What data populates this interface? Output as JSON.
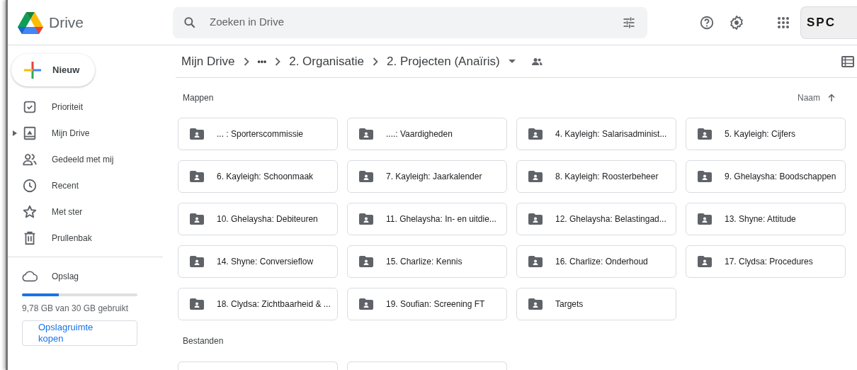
{
  "app": {
    "name": "Drive"
  },
  "search": {
    "placeholder": "Zoeken in Drive"
  },
  "account": {
    "logo_text": "SPC"
  },
  "new_button": {
    "label": "Nieuw"
  },
  "sidebar": {
    "items": [
      {
        "kind": "priority",
        "label": "Prioriteit",
        "expander": false
      },
      {
        "kind": "my-drive",
        "label": "Mijn Drive",
        "expander": true
      },
      {
        "kind": "shared",
        "label": "Gedeeld met mij",
        "expander": false
      },
      {
        "kind": "recent",
        "label": "Recent",
        "expander": false
      },
      {
        "kind": "starred",
        "label": "Met ster",
        "expander": false
      },
      {
        "kind": "trash",
        "label": "Prullenbak",
        "expander": false
      }
    ],
    "storage": {
      "label": "Opslag",
      "level": 0.32,
      "usage": "9,78 GB van 30 GB gebruikt",
      "buy_button": "Opslagruimte kopen"
    }
  },
  "breadcrumb": [
    {
      "kind": "link",
      "label": "Mijn Drive"
    },
    {
      "kind": "more",
      "label": "•••"
    },
    {
      "kind": "link",
      "label": "2. Organisatie"
    },
    {
      "kind": "current",
      "label": "2. Projecten (Anaïris)"
    }
  ],
  "folders_section": {
    "title": "Mappen",
    "sort_label": "Naam"
  },
  "folders": [
    {
      "name": "... : Sporterscommissie"
    },
    {
      "name": "....: Vaardigheden"
    },
    {
      "name": "4. Kayleigh: Salarisadminist..."
    },
    {
      "name": "5. Kayleigh: Cijfers"
    },
    {
      "name": "6. Kayleigh: Schoonmaak"
    },
    {
      "name": "7. Kayleigh: Jaarkalender"
    },
    {
      "name": "8. Kayleigh: Roosterbeheer"
    },
    {
      "name": "9. Ghelaysha: Boodschappen"
    },
    {
      "name": "10. Ghelaysha: Debiteuren"
    },
    {
      "name": "11. Ghelaysha: In- en uitdie..."
    },
    {
      "name": "12. Ghelaysha: Belastingad..."
    },
    {
      "name": "13. Shyne: Attitude"
    },
    {
      "name": "14. Shyne: Conversieflow"
    },
    {
      "name": "15. Charlize: Kennis"
    },
    {
      "name": "16. Charlize: Onderhoud"
    },
    {
      "name": "17. Clydsa: Procedures"
    },
    {
      "name": "18. Clydsa: Zichtbaarheid & ..."
    },
    {
      "name": "19. Soufian: Screening FT"
    },
    {
      "name": "Targets"
    }
  ],
  "files_section": {
    "title": "Bestanden"
  },
  "files": [
    {
      "kind": "file"
    },
    {
      "kind": "file"
    }
  ]
}
